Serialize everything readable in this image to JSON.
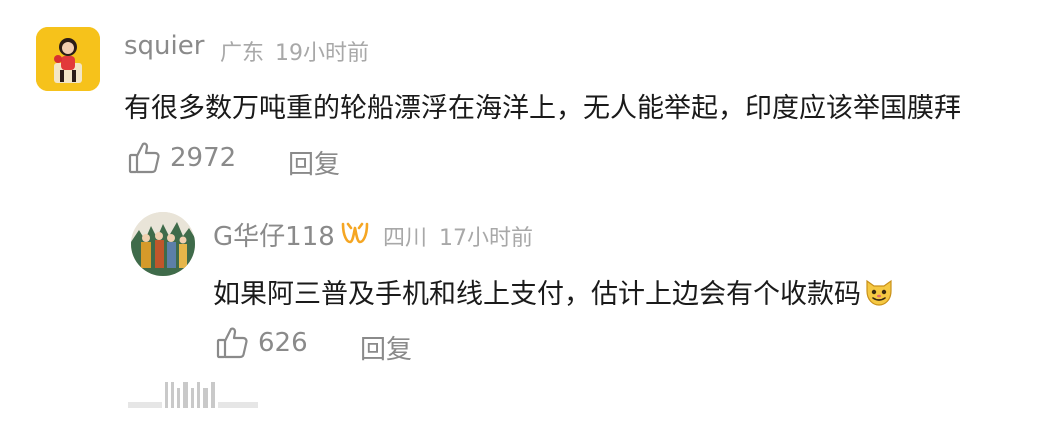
{
  "comment": {
    "user": "squier",
    "location": "广东",
    "time": "19小时前",
    "text": "有很多数万吨重的轮船漂浮在海洋上，无人能举起，印度应该举国膜拜",
    "likes": "2972",
    "reply_label": "回复"
  },
  "reply": {
    "user": "G华仔118",
    "location": "四川",
    "time": "17小时前",
    "text": "如果阿三普及手机和线上支付，估计上边会有个收款码",
    "likes": "626",
    "reply_label": "回复"
  },
  "icons": {
    "like": "thumbs-up-icon",
    "badge": "vip-badge-icon",
    "emoji": "cat-emoji-icon"
  },
  "colors": {
    "badge": "#f5a623",
    "meta": "#a8a8a8"
  }
}
